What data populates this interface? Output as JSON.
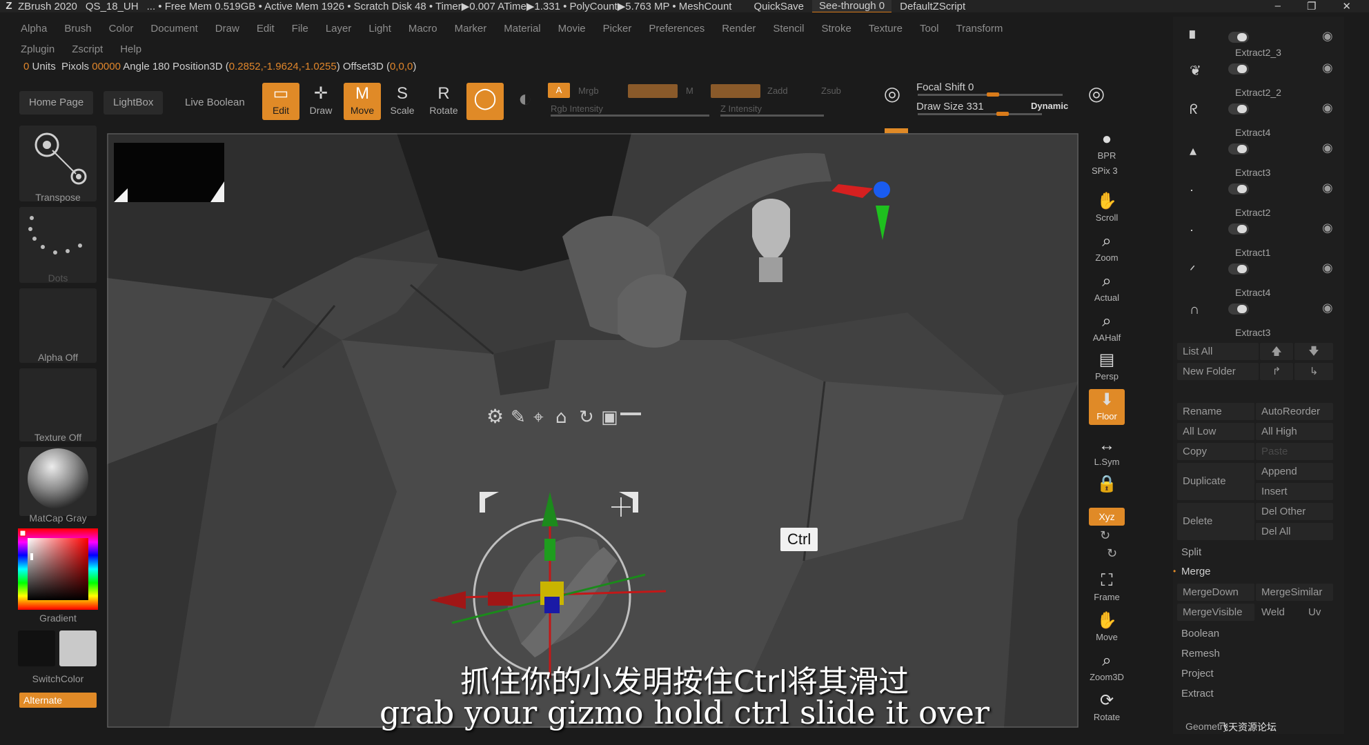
{
  "titlebar": {
    "app": "ZBrush 2020",
    "file": "QS_18_UH",
    "stats": "... • Free Mem 0.519GB • Active Mem 1926 • Scratch Disk 48 •  Timer▶0.007 ATime▶1.331 • PolyCount▶5.763 MP  • MeshCount",
    "quicksave": "QuickSave",
    "seethrough": "See-through  0",
    "script": "DefaultZScript"
  },
  "menu": {
    "row1": [
      "Alpha",
      "Brush",
      "Color",
      "Document",
      "Draw",
      "Edit",
      "File",
      "Layer",
      "Light",
      "Macro",
      "Marker",
      "Material",
      "Movie",
      "Picker",
      "Preferences",
      "Render",
      "Stencil",
      "Stroke",
      "Texture",
      "Tool",
      "Transform"
    ],
    "row2": [
      "Zplugin",
      "Zscript",
      "Help"
    ]
  },
  "info": {
    "units_value": "0",
    "units": "Units",
    "pixols_label": "Pixols",
    "pixols_value": "00000",
    "angle_label": "Angle",
    "angle_value": "180",
    "pos_label": "Position3D (",
    "pos_value": "0.2852,-1.9624,-1.0255",
    "offset_label": ") Offset3D (",
    "offset_value": "0,0,0",
    "close": ")"
  },
  "shelf": {
    "home": "Home Page",
    "lightbox": "LightBox",
    "liveboolean": "Live Boolean",
    "edit": "Edit",
    "draw": "Draw",
    "move": "Move",
    "scale": "Scale",
    "rotate": "Rotate",
    "a_badge": "A",
    "mrgb": "Mrgb",
    "rgb": "Rgb",
    "m": "M",
    "zadd": "Zadd",
    "zsub": "Zsub",
    "rgb_intensity": "Rgb Intensity",
    "z_intensity": "Z Intensity",
    "focal_shift": "Focal Shift 0",
    "draw_size": "Draw Size 331",
    "dynamic": "Dynamic"
  },
  "left": {
    "transpose": "Transpose",
    "dots": "Dots",
    "alpha_off": "Alpha Off",
    "texture_off": "Texture Off",
    "matcap": "MatCap Gray",
    "gradient": "Gradient",
    "switchcolor": "SwitchColor",
    "alternate": "Alternate"
  },
  "viewport": {
    "ctrl_tooltip": "Ctrl"
  },
  "rightcol": [
    {
      "label": "BPR",
      "sub": "SPix 3"
    },
    {
      "label": "Scroll"
    },
    {
      "label": "Zoom"
    },
    {
      "label": "Actual"
    },
    {
      "label": "AAHalf"
    },
    {
      "label": "Persp"
    },
    {
      "label": "Floor"
    },
    {
      "label": "L.Sym"
    },
    {
      "label": "Frame"
    },
    {
      "label": "Move"
    },
    {
      "label": "Zoom3D"
    },
    {
      "label": "Rotate"
    }
  ],
  "subtools": {
    "items": [
      "Extract2_3",
      "Extract2_2",
      "Extract4",
      "Extract3",
      "Extract2",
      "Extract1",
      "Extract4",
      "Extract3"
    ],
    "list_all": "List All",
    "new_folder": "New Folder",
    "rename": "Rename",
    "autoreorder": "AutoReorder",
    "all_low": "All Low",
    "all_high": "All High",
    "copy": "Copy",
    "paste": "Paste",
    "append": "Append",
    "duplicate": "Duplicate",
    "insert": "Insert",
    "delete": "Delete",
    "del_other": "Del Other",
    "del_all": "Del All",
    "split": "Split",
    "merge": "Merge",
    "mergedown": "MergeDown",
    "mergesimilar": "MergeSimilar",
    "mergevisible": "MergeVisible",
    "weld": "Weld",
    "uv": "Uv",
    "boolean": "Boolean",
    "remesh": "Remesh",
    "project": "Project",
    "extract": "Extract",
    "geometry": "Geometry"
  },
  "subtitle": {
    "cn": "抓住你的小发明按住Ctrl将其滑过",
    "en": "grab your gizmo hold ctrl slide it over"
  },
  "watermark": "飞天资源论坛",
  "colors": {
    "accent": "#e08a27",
    "panel": "#262626",
    "viewport": "#3e3e3e"
  }
}
